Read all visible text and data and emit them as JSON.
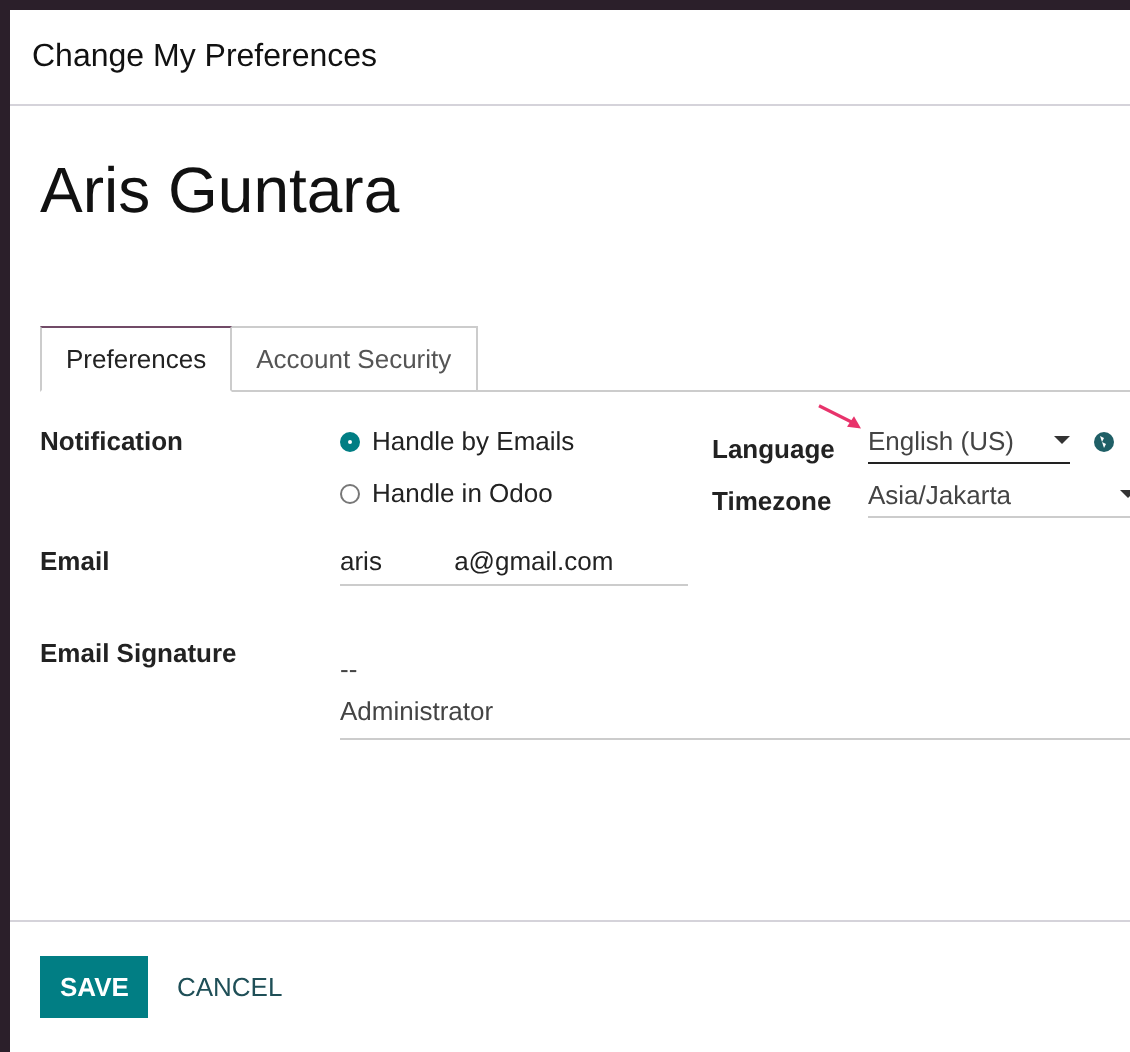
{
  "dialog": {
    "title": "Change My Preferences"
  },
  "user": {
    "name": "Aris Guntara"
  },
  "tabs": [
    {
      "label": "Preferences",
      "selected": true
    },
    {
      "label": "Account Security",
      "selected": false
    }
  ],
  "notification": {
    "label": "Notification",
    "options": [
      {
        "label": "Handle by Emails",
        "selected": true
      },
      {
        "label": "Handle in Odoo",
        "selected": false
      }
    ]
  },
  "language": {
    "label": "Language",
    "value": "English (US)",
    "focused": true
  },
  "timezone": {
    "label": "Timezone",
    "value": "Asia/Jakarta",
    "focused": false
  },
  "email": {
    "label": "Email",
    "value": "aris          a@gmail.com"
  },
  "signature": {
    "label": "Email Signature",
    "lines": [
      "--",
      "Administrator"
    ]
  },
  "buttons": [
    {
      "label": "SAVE",
      "kind": "primary"
    },
    {
      "label": "CANCEL",
      "kind": "secondary"
    }
  ]
}
